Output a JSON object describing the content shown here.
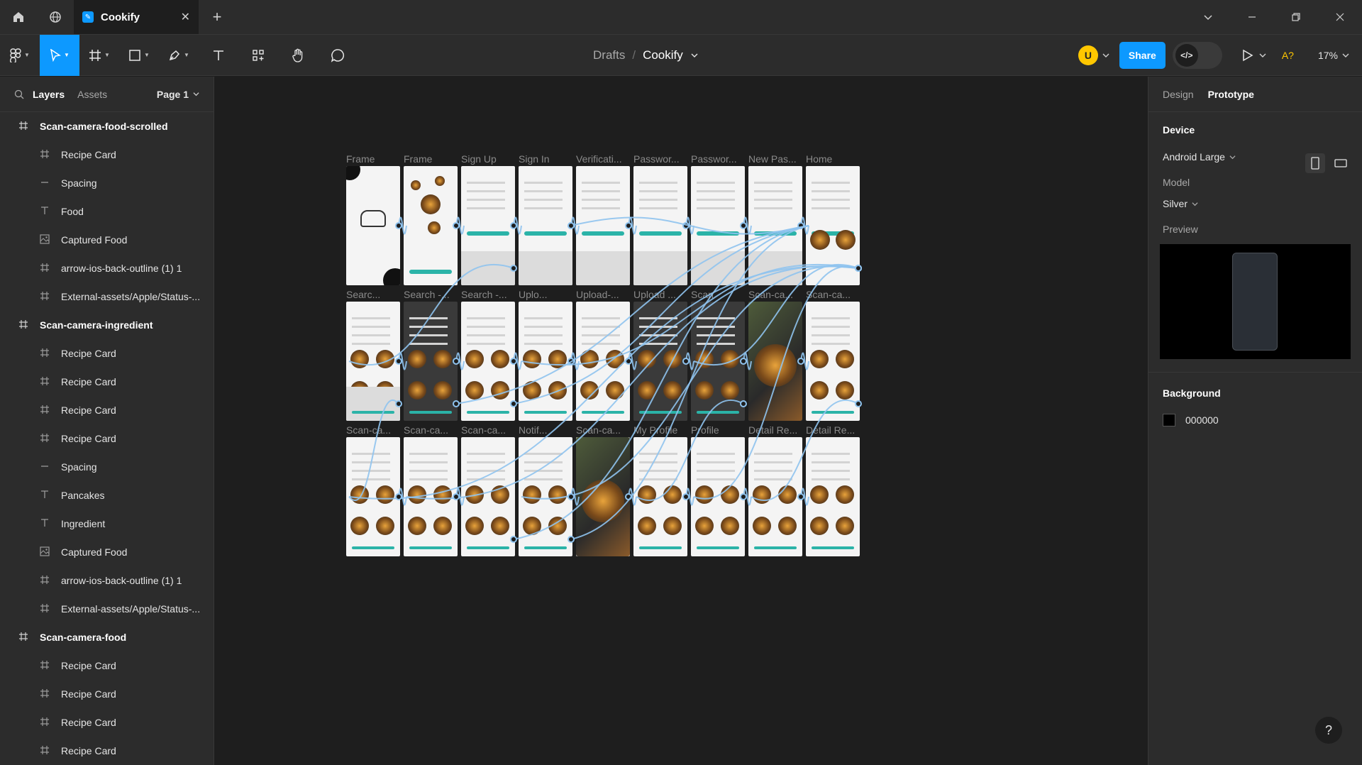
{
  "titlebar": {
    "tab_title": "Cookify",
    "tab_close": "✕",
    "new_tab": "+"
  },
  "toolbar": {
    "breadcrumb_parent": "Drafts",
    "breadcrumb_sep": "/",
    "file_name": "Cookify",
    "avatar_letter": "U",
    "share_label": "Share",
    "zoom": "17%",
    "aa_label": "A?"
  },
  "left_panel": {
    "tab_layers": "Layers",
    "tab_assets": "Assets",
    "page": "Page 1",
    "layers": [
      {
        "label": "Scan-camera-food-scrolled",
        "level": 0,
        "icon": "frame"
      },
      {
        "label": "Recipe Card",
        "level": 1,
        "icon": "frame"
      },
      {
        "label": "Spacing",
        "level": 1,
        "icon": "line"
      },
      {
        "label": "Food",
        "level": 1,
        "icon": "text"
      },
      {
        "label": "Captured Food",
        "level": 1,
        "icon": "image"
      },
      {
        "label": "arrow-ios-back-outline (1) 1",
        "level": 1,
        "icon": "frame"
      },
      {
        "label": "External-assets/Apple/Status-...",
        "level": 1,
        "icon": "frame"
      },
      {
        "label": "Scan-camera-ingredient",
        "level": 0,
        "icon": "frame"
      },
      {
        "label": "Recipe Card",
        "level": 1,
        "icon": "frame"
      },
      {
        "label": "Recipe Card",
        "level": 1,
        "icon": "frame"
      },
      {
        "label": "Recipe Card",
        "level": 1,
        "icon": "frame"
      },
      {
        "label": "Recipe Card",
        "level": 1,
        "icon": "frame"
      },
      {
        "label": "Spacing",
        "level": 1,
        "icon": "line"
      },
      {
        "label": "Pancakes",
        "level": 1,
        "icon": "text"
      },
      {
        "label": "Ingredient",
        "level": 1,
        "icon": "text"
      },
      {
        "label": "Captured Food",
        "level": 1,
        "icon": "image"
      },
      {
        "label": "arrow-ios-back-outline (1) 1",
        "level": 1,
        "icon": "frame"
      },
      {
        "label": "External-assets/Apple/Status-...",
        "level": 1,
        "icon": "frame"
      },
      {
        "label": "Scan-camera-food",
        "level": 0,
        "icon": "frame"
      },
      {
        "label": "Recipe Card",
        "level": 1,
        "icon": "frame"
      },
      {
        "label": "Recipe Card",
        "level": 1,
        "icon": "frame"
      },
      {
        "label": "Recipe Card",
        "level": 1,
        "icon": "frame"
      },
      {
        "label": "Recipe Card",
        "level": 1,
        "icon": "frame"
      }
    ]
  },
  "canvas": {
    "rows": [
      [
        "Frame",
        "Frame",
        "Sign Up",
        "Sign In",
        "Verificati...",
        "Passwor...",
        "Passwor...",
        "New Pas...",
        "Home"
      ],
      [
        "Searc...",
        "Search -...",
        "Search -...",
        "Uplo...",
        "Upload-...",
        "Upload ...",
        "Scan",
        "Scan-ca...",
        "Scan-ca..."
      ],
      [
        "Scan-ca...",
        "Scan-ca...",
        "Scan-ca...",
        "Notif...",
        "Scan-ca...",
        "My Profile",
        "Profile",
        "Detail Re...",
        "Detail Re..."
      ]
    ]
  },
  "right_panel": {
    "tab_design": "Design",
    "tab_prototype": "Prototype",
    "device_title": "Device",
    "device_value": "Android Large",
    "model_label": "Model",
    "model_value": "Silver",
    "preview_label": "Preview",
    "background_title": "Background",
    "background_hex": "000000",
    "help": "?"
  },
  "colors": {
    "accent": "#0d99ff",
    "panel": "#2c2c2c",
    "canvas": "#1e1e1e",
    "brand_teal": "#2bb3a8"
  }
}
